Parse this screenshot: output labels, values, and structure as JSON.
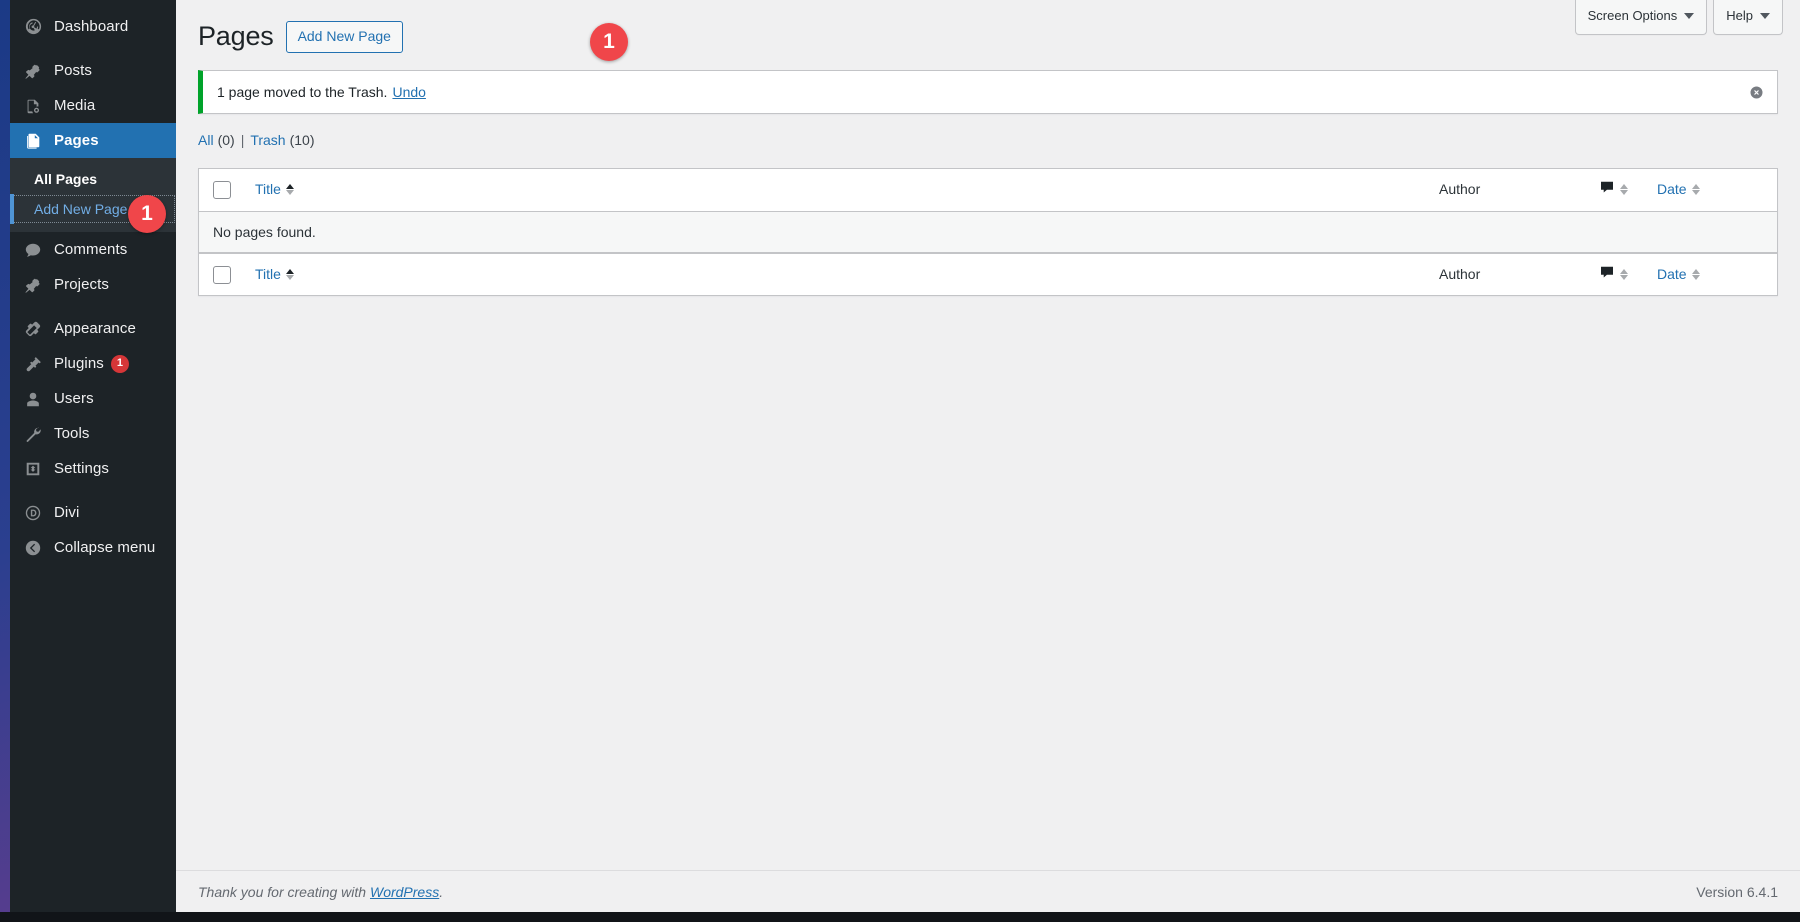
{
  "sidebar": {
    "items": [
      {
        "label": "Dashboard",
        "icon": "dashboard-icon",
        "sep_before": false,
        "current": false
      },
      {
        "label": "Posts",
        "icon": "pin-icon",
        "sep_before": true,
        "current": false
      },
      {
        "label": "Media",
        "icon": "media-icon",
        "sep_before": false,
        "current": false
      },
      {
        "label": "Pages",
        "icon": "pages-icon",
        "sep_before": false,
        "current": true
      },
      {
        "label": "Comments",
        "icon": "comment-icon",
        "sep_before": false,
        "current": false
      },
      {
        "label": "Projects",
        "icon": "pin-icon",
        "sep_before": false,
        "current": false
      },
      {
        "label": "Appearance",
        "icon": "brush-icon",
        "sep_before": true,
        "current": false
      },
      {
        "label": "Plugins",
        "icon": "plug-icon",
        "sep_before": false,
        "current": false,
        "badge": "1"
      },
      {
        "label": "Users",
        "icon": "user-icon",
        "sep_before": false,
        "current": false
      },
      {
        "label": "Tools",
        "icon": "wrench-icon",
        "sep_before": false,
        "current": false
      },
      {
        "label": "Settings",
        "icon": "settings-icon",
        "sep_before": false,
        "current": false
      },
      {
        "label": "Divi",
        "icon": "divi-icon",
        "sep_before": true,
        "current": false
      },
      {
        "label": "Collapse menu",
        "icon": "collapse-icon",
        "sep_before": false,
        "current": false
      }
    ],
    "submenu": {
      "after_item": "Pages",
      "items": [
        {
          "label": "All Pages",
          "current": true,
          "focused": false
        },
        {
          "label": "Add New Page",
          "current": false,
          "focused": true
        }
      ]
    }
  },
  "annotations": [
    {
      "id": "annot-sidebar",
      "number": "1"
    },
    {
      "id": "annot-header",
      "number": "1"
    }
  ],
  "screen_meta": {
    "screen_options_label": "Screen Options",
    "help_label": "Help"
  },
  "header": {
    "title": "Pages",
    "add_new_label": "Add New Page"
  },
  "notice": {
    "message": "1 page moved to the Trash.",
    "undo_label": "Undo",
    "dismiss_icon": "dismiss-icon"
  },
  "filters": [
    {
      "label": "All",
      "count": "(0)"
    },
    {
      "label": "Trash",
      "count": "(10)"
    }
  ],
  "filter_separator": "|",
  "table": {
    "columns": {
      "select_all": "select-all-checkbox",
      "title": "Title",
      "author": "Author",
      "comments": "comments-icon",
      "date": "Date"
    },
    "no_items_text": "No pages found.",
    "rows": []
  },
  "footer": {
    "thanks_prefix": "Thank you for creating with ",
    "wordpress_label": "WordPress",
    "thanks_suffix": ".",
    "version": "Version 6.4.1"
  },
  "colors": {
    "sidebar_bg": "#1d2327",
    "submenu_bg": "#2c3338",
    "current_menu": "#2271b1",
    "link": "#2271b1",
    "notice_accent": "#00a32a",
    "badge_red": "#d63638",
    "annotation_red": "#f0464a",
    "content_bg": "#f0f0f1"
  }
}
